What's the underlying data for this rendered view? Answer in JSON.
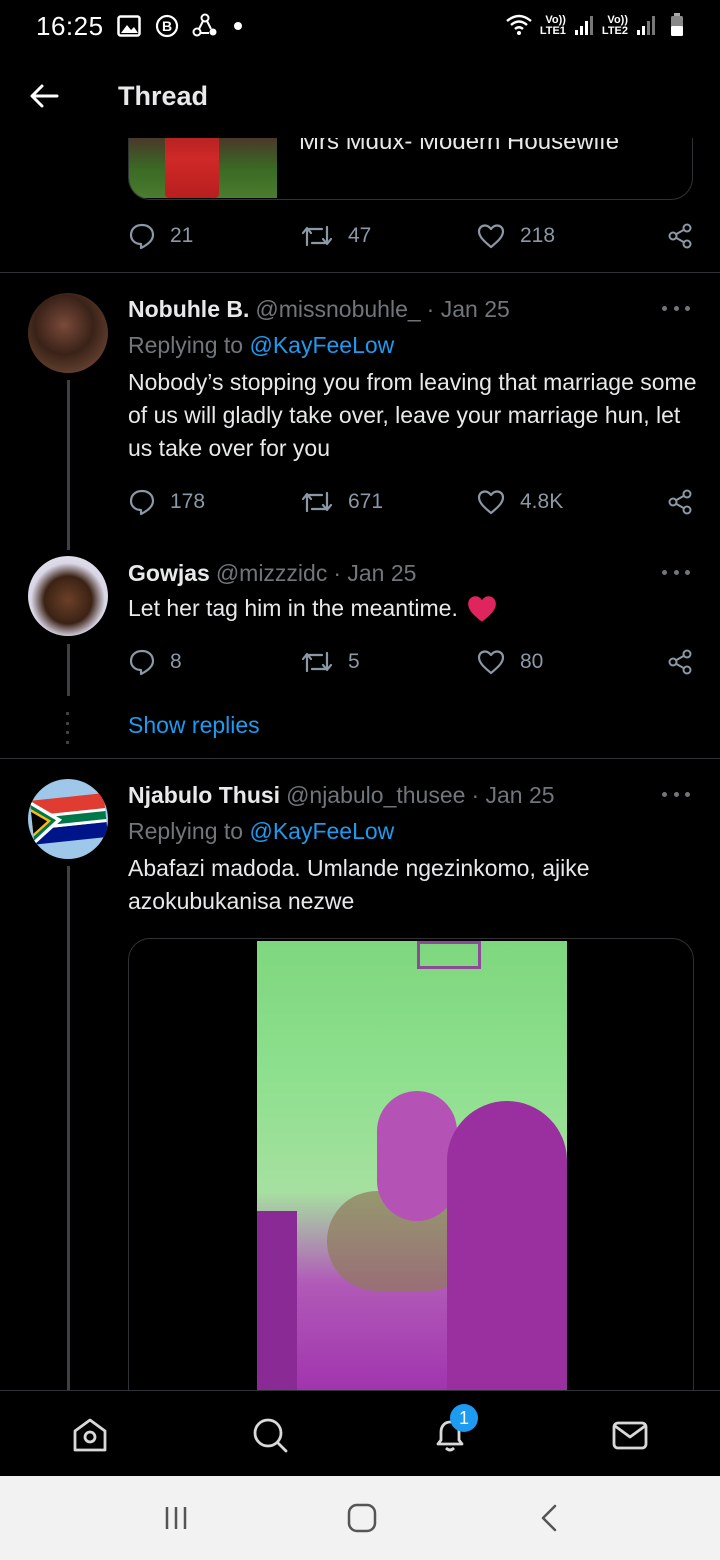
{
  "status_bar": {
    "time": "16:25",
    "sim1_label": "LTE1",
    "sim2_label": "LTE2",
    "volte1": "Vo))",
    "volte2": "Vo))"
  },
  "header": {
    "title": "Thread"
  },
  "top_tweet": {
    "card_title": "Mrs Mdux- Modern Housewife",
    "stats": {
      "replies": "21",
      "retweets": "47",
      "likes": "218"
    }
  },
  "replies": [
    {
      "name": "Nobuhle B.",
      "handle": "@missnobuhle_",
      "date": "· Jan 25",
      "replying_label": "Replying to",
      "replying_to": "@KayFeeLow",
      "text": "Nobody’s stopping you from leaving that marriage some of us will gladly take over, leave your marriage hun, let us take over for you",
      "stats": {
        "replies": "178",
        "retweets": "671",
        "likes": "4.8K"
      }
    },
    {
      "name": "Gowjas",
      "handle": "@mizzzidc",
      "date": "· Jan 25",
      "text": "Let her tag him in the meantime.",
      "stats": {
        "replies": "8",
        "retweets": "5",
        "likes": "80"
      }
    },
    {
      "name": "Njabulo Thusi",
      "handle": "@njabulo_thusee",
      "date": "· Jan 25",
      "replying_label": "Replying to",
      "replying_to": "@KayFeeLow",
      "text": "Abafazi madoda. Umlande ngezinkomo, ajike azokubukanisa nezwe"
    }
  ],
  "show_replies_label": "Show replies",
  "bottom_nav": {
    "notifications_badge": "1"
  },
  "colors": {
    "accent": "#1d9bf0",
    "background": "#000000",
    "muted": "#71767b",
    "heart": "#e0245e"
  }
}
